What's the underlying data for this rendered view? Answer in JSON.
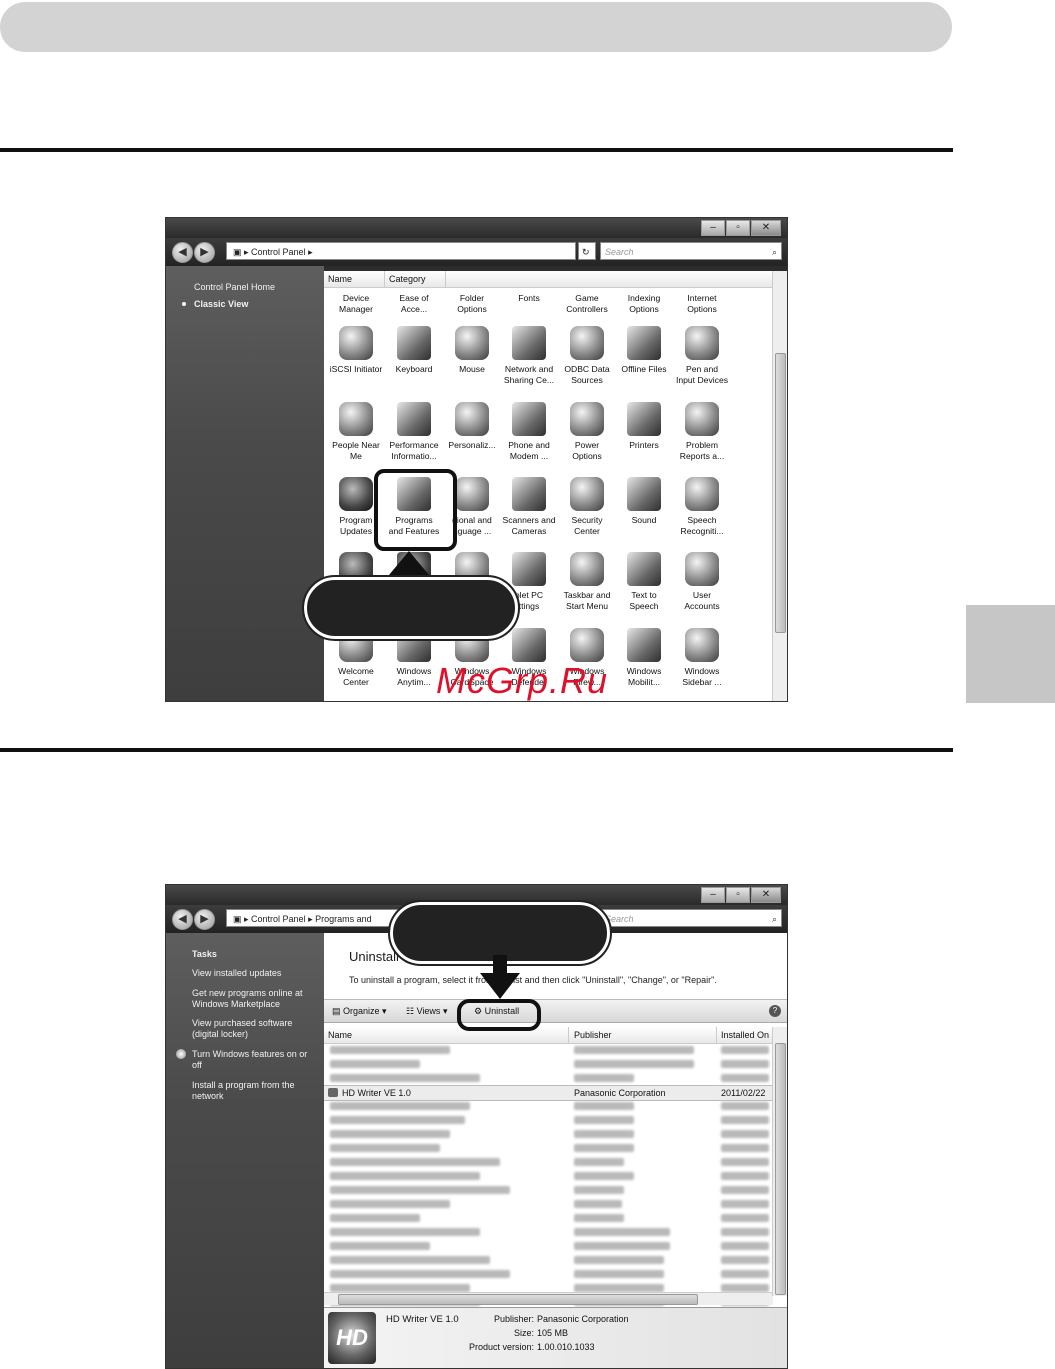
{
  "window1": {
    "breadcrumb": [
      "Control Panel"
    ],
    "search_placeholder": "Search",
    "left_pane": {
      "home": "Control Panel Home",
      "classic_view": "Classic View"
    },
    "columns": [
      "Name",
      "Category"
    ],
    "items": [
      [
        "Device",
        "Manager"
      ],
      [
        "Ease of",
        "Acce..."
      ],
      [
        "Folder",
        "Options"
      ],
      [
        "Fonts",
        ""
      ],
      [
        "Game",
        "Controllers"
      ],
      [
        "Indexing",
        "Options"
      ],
      [
        "Internet",
        "Options"
      ],
      [
        "iSCSI Initiator",
        ""
      ],
      [
        "Keyboard",
        ""
      ],
      [
        "Mouse",
        ""
      ],
      [
        "Network and",
        "Sharing Ce..."
      ],
      [
        "ODBC Data",
        "Sources"
      ],
      [
        "Offline Files",
        ""
      ],
      [
        "Pen and",
        "Input Devices"
      ],
      [
        "People Near",
        "Me"
      ],
      [
        "Performance",
        "Informatio..."
      ],
      [
        "Personaliz...",
        ""
      ],
      [
        "Phone and",
        "Modem ..."
      ],
      [
        "Power",
        "Options"
      ],
      [
        "Printers",
        ""
      ],
      [
        "Problem",
        "Reports a..."
      ],
      [
        "Program",
        "Updates"
      ],
      [
        "Programs",
        "and Features"
      ],
      [
        "gional and",
        "nguage ..."
      ],
      [
        "Scanners and",
        "Cameras"
      ],
      [
        "Security",
        "Center"
      ],
      [
        "Sound",
        ""
      ],
      [
        "Speech",
        "Recogniti..."
      ],
      [
        "",
        ""
      ],
      [
        "",
        ""
      ],
      [
        "",
        ""
      ],
      [
        "blet PC",
        "ttings"
      ],
      [
        "Taskbar and",
        "Start Menu"
      ],
      [
        "Text to",
        "Speech"
      ],
      [
        "User",
        "Accounts"
      ],
      [
        "Welcome",
        "Center"
      ],
      [
        "Windows",
        "Anytim..."
      ],
      [
        "Windows",
        "CardSpace"
      ],
      [
        "Windows",
        "Defender"
      ],
      [
        "Windows",
        "Firew..."
      ],
      [
        "Windows",
        "Mobilit..."
      ],
      [
        "Windows",
        "Sidebar ..."
      ]
    ]
  },
  "watermark": "McGrp.Ru",
  "window2": {
    "breadcrumb": [
      "Control Panel",
      "Programs and"
    ],
    "search_placeholder": "Search",
    "left_pane": {
      "tasks": "Tasks",
      "view_updates": "View installed updates",
      "get_new_1": "Get new programs online at",
      "get_new_2": "Windows Marketplace",
      "purchased_1": "View purchased software",
      "purchased_2": "(digital locker)",
      "features_1": "Turn Windows features on or",
      "features_2": "off",
      "network_1": "Install a program from the",
      "network_2": "network"
    },
    "page_title": "Uninstall or change a program",
    "description": "To uninstall a program, select it from the list and then click \"Uninstall\", \"Change\", or \"Repair\".",
    "toolbar": {
      "organize": "Organize",
      "views": "Views",
      "uninstall": "Uninstall"
    },
    "columns": [
      "Name",
      "Publisher",
      "Installed On"
    ],
    "selected_row": {
      "name": "HD Writer VE 1.0",
      "publisher": "Panasonic Corporation",
      "installed": "2011/02/22"
    },
    "details": {
      "name": "HD Writer VE 1.0",
      "publisher_label": "Publisher:",
      "publisher": "Panasonic Corporation",
      "size_label": "Size:",
      "size": "105 MB",
      "version_label": "Product version:",
      "version": "1.00.010.1033",
      "logo": "HD"
    }
  }
}
